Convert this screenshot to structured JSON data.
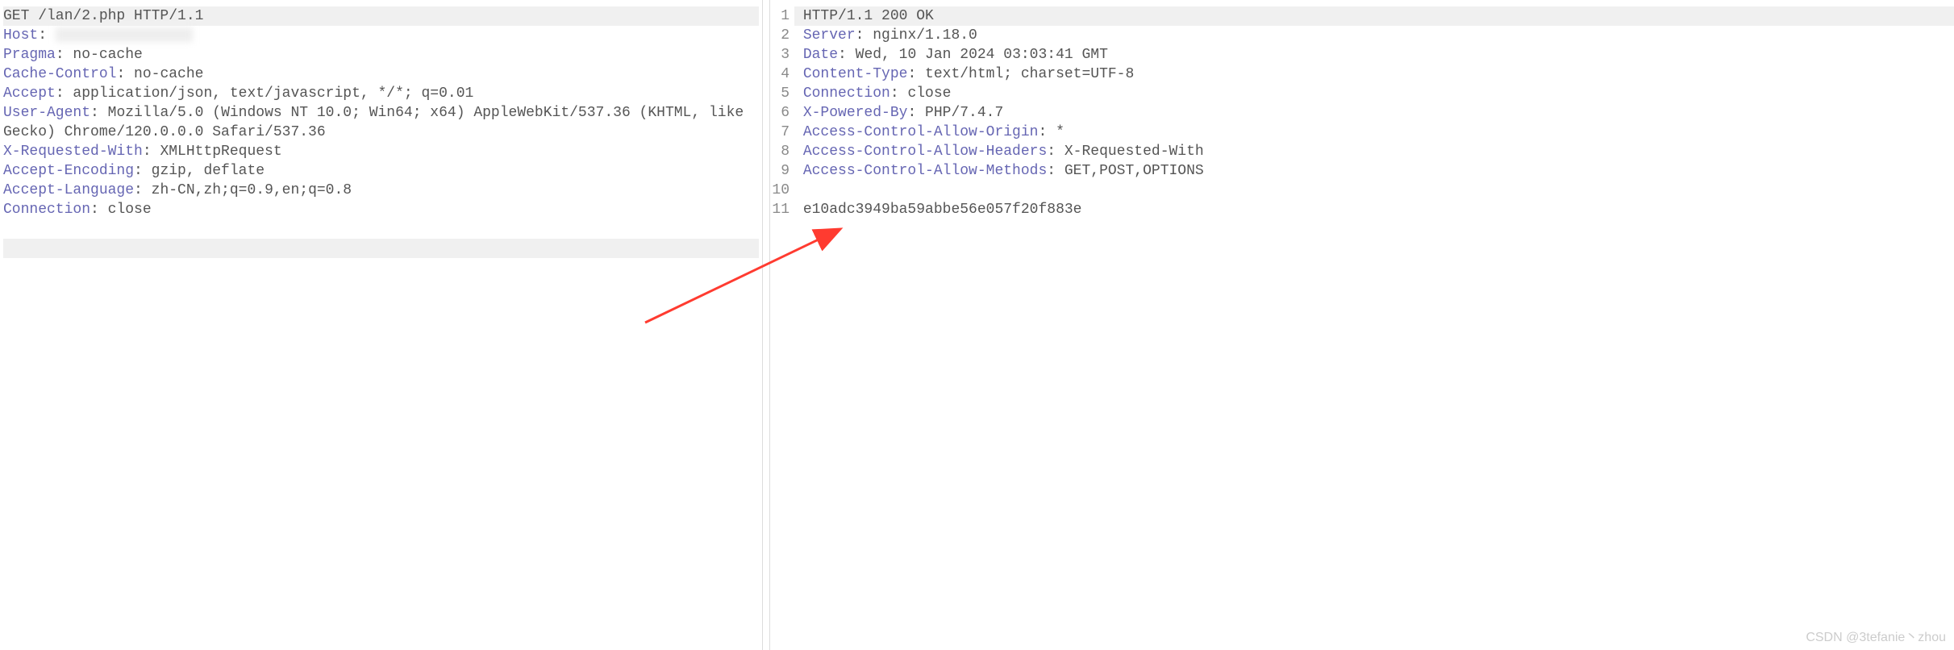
{
  "request": {
    "line": "GET /lan/2.php HTTP/1.1",
    "headers": [
      {
        "name": "Host",
        "value": ""
      },
      {
        "name": "Pragma",
        "value": "no-cache"
      },
      {
        "name": "Cache-Control",
        "value": "no-cache"
      },
      {
        "name": "Accept",
        "value": "application/json, text/javascript, */*; q=0.01"
      },
      {
        "name": "User-Agent",
        "value": "Mozilla/5.0 (Windows NT 10.0; Win64; x64) AppleWebKit/537.36 (KHTML, like Gecko) Chrome/120.0.0.0 Safari/537.36"
      },
      {
        "name": "X-Requested-With",
        "value": "XMLHttpRequest"
      },
      {
        "name": "Accept-Encoding",
        "value": "gzip, deflate"
      },
      {
        "name": "Accept-Language",
        "value": "zh-CN,zh;q=0.9,en;q=0.8"
      },
      {
        "name": "Connection",
        "value": "close"
      }
    ]
  },
  "response": {
    "status_line": "HTTP/1.1 200 OK",
    "headers": [
      {
        "name": "Server",
        "value": "nginx/1.18.0"
      },
      {
        "name": "Date",
        "value": "Wed, 10 Jan 2024 03:03:41 GMT"
      },
      {
        "name": "Content-Type",
        "value": "text/html; charset=UTF-8"
      },
      {
        "name": "Connection",
        "value": "close"
      },
      {
        "name": "X-Powered-By",
        "value": "PHP/7.4.7"
      },
      {
        "name": "Access-Control-Allow-Origin",
        "value": "*"
      },
      {
        "name": "Access-Control-Allow-Headers",
        "value": "X-Requested-With"
      },
      {
        "name": "Access-Control-Allow-Methods",
        "value": "GET,POST,OPTIONS"
      }
    ],
    "body": "e10adc3949ba59abbe56e057f20f883e",
    "line_numbers": [
      "1",
      "2",
      "3",
      "4",
      "5",
      "6",
      "7",
      "8",
      "9",
      "10",
      "11"
    ]
  },
  "watermark": "CSDN @3tefanie丶zhou"
}
